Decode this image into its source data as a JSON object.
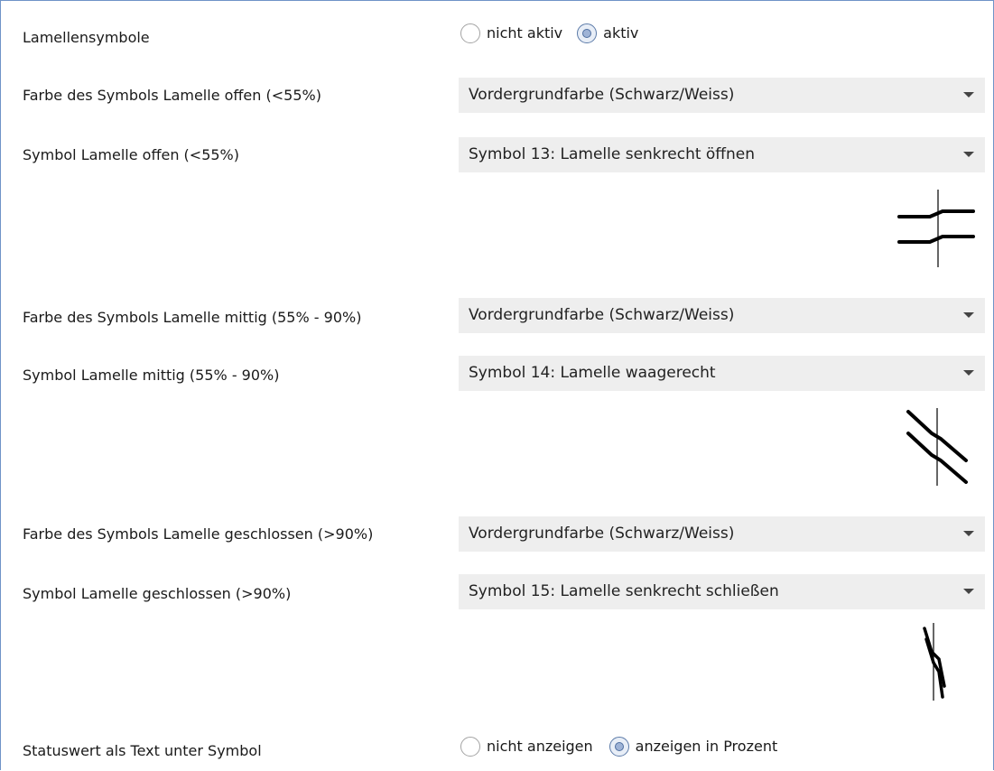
{
  "lamellensymbole": {
    "label": "Lamellensymbole",
    "options": [
      {
        "label": "nicht aktiv",
        "checked": false
      },
      {
        "label": "aktiv",
        "checked": true
      }
    ]
  },
  "offen": {
    "color_label": "Farbe des Symbols Lamelle offen (<55%)",
    "color_value": "Vordergrundfarbe (Schwarz/Weiss)",
    "symbol_label": "Symbol Lamelle offen (<55%)",
    "symbol_value": "Symbol 13: Lamelle senkrecht öffnen",
    "preview_icon": "lamella-open-icon"
  },
  "mittig": {
    "color_label": "Farbe des Symbols Lamelle mittig (55% - 90%)",
    "color_value": "Vordergrundfarbe (Schwarz/Weiss)",
    "symbol_label": "Symbol Lamelle mittig (55% - 90%)",
    "symbol_value": "Symbol 14: Lamelle waagerecht",
    "preview_icon": "lamella-middle-icon"
  },
  "geschlossen": {
    "color_label": "Farbe des Symbols Lamelle geschlossen (>90%)",
    "color_value": "Vordergrundfarbe (Schwarz/Weiss)",
    "symbol_label": "Symbol Lamelle geschlossen (>90%)",
    "symbol_value": "Symbol 15: Lamelle senkrecht schließen",
    "preview_icon": "lamella-closed-icon"
  },
  "statuswert": {
    "label": "Statuswert als Text unter Symbol",
    "options": [
      {
        "label": "nicht anzeigen",
        "checked": false
      },
      {
        "label": "anzeigen in Prozent",
        "checked": true
      }
    ]
  },
  "colors": {
    "frame_border": "#6f93c8",
    "select_bg": "#eeeeee",
    "radio_checked": "#9eb3d6"
  }
}
